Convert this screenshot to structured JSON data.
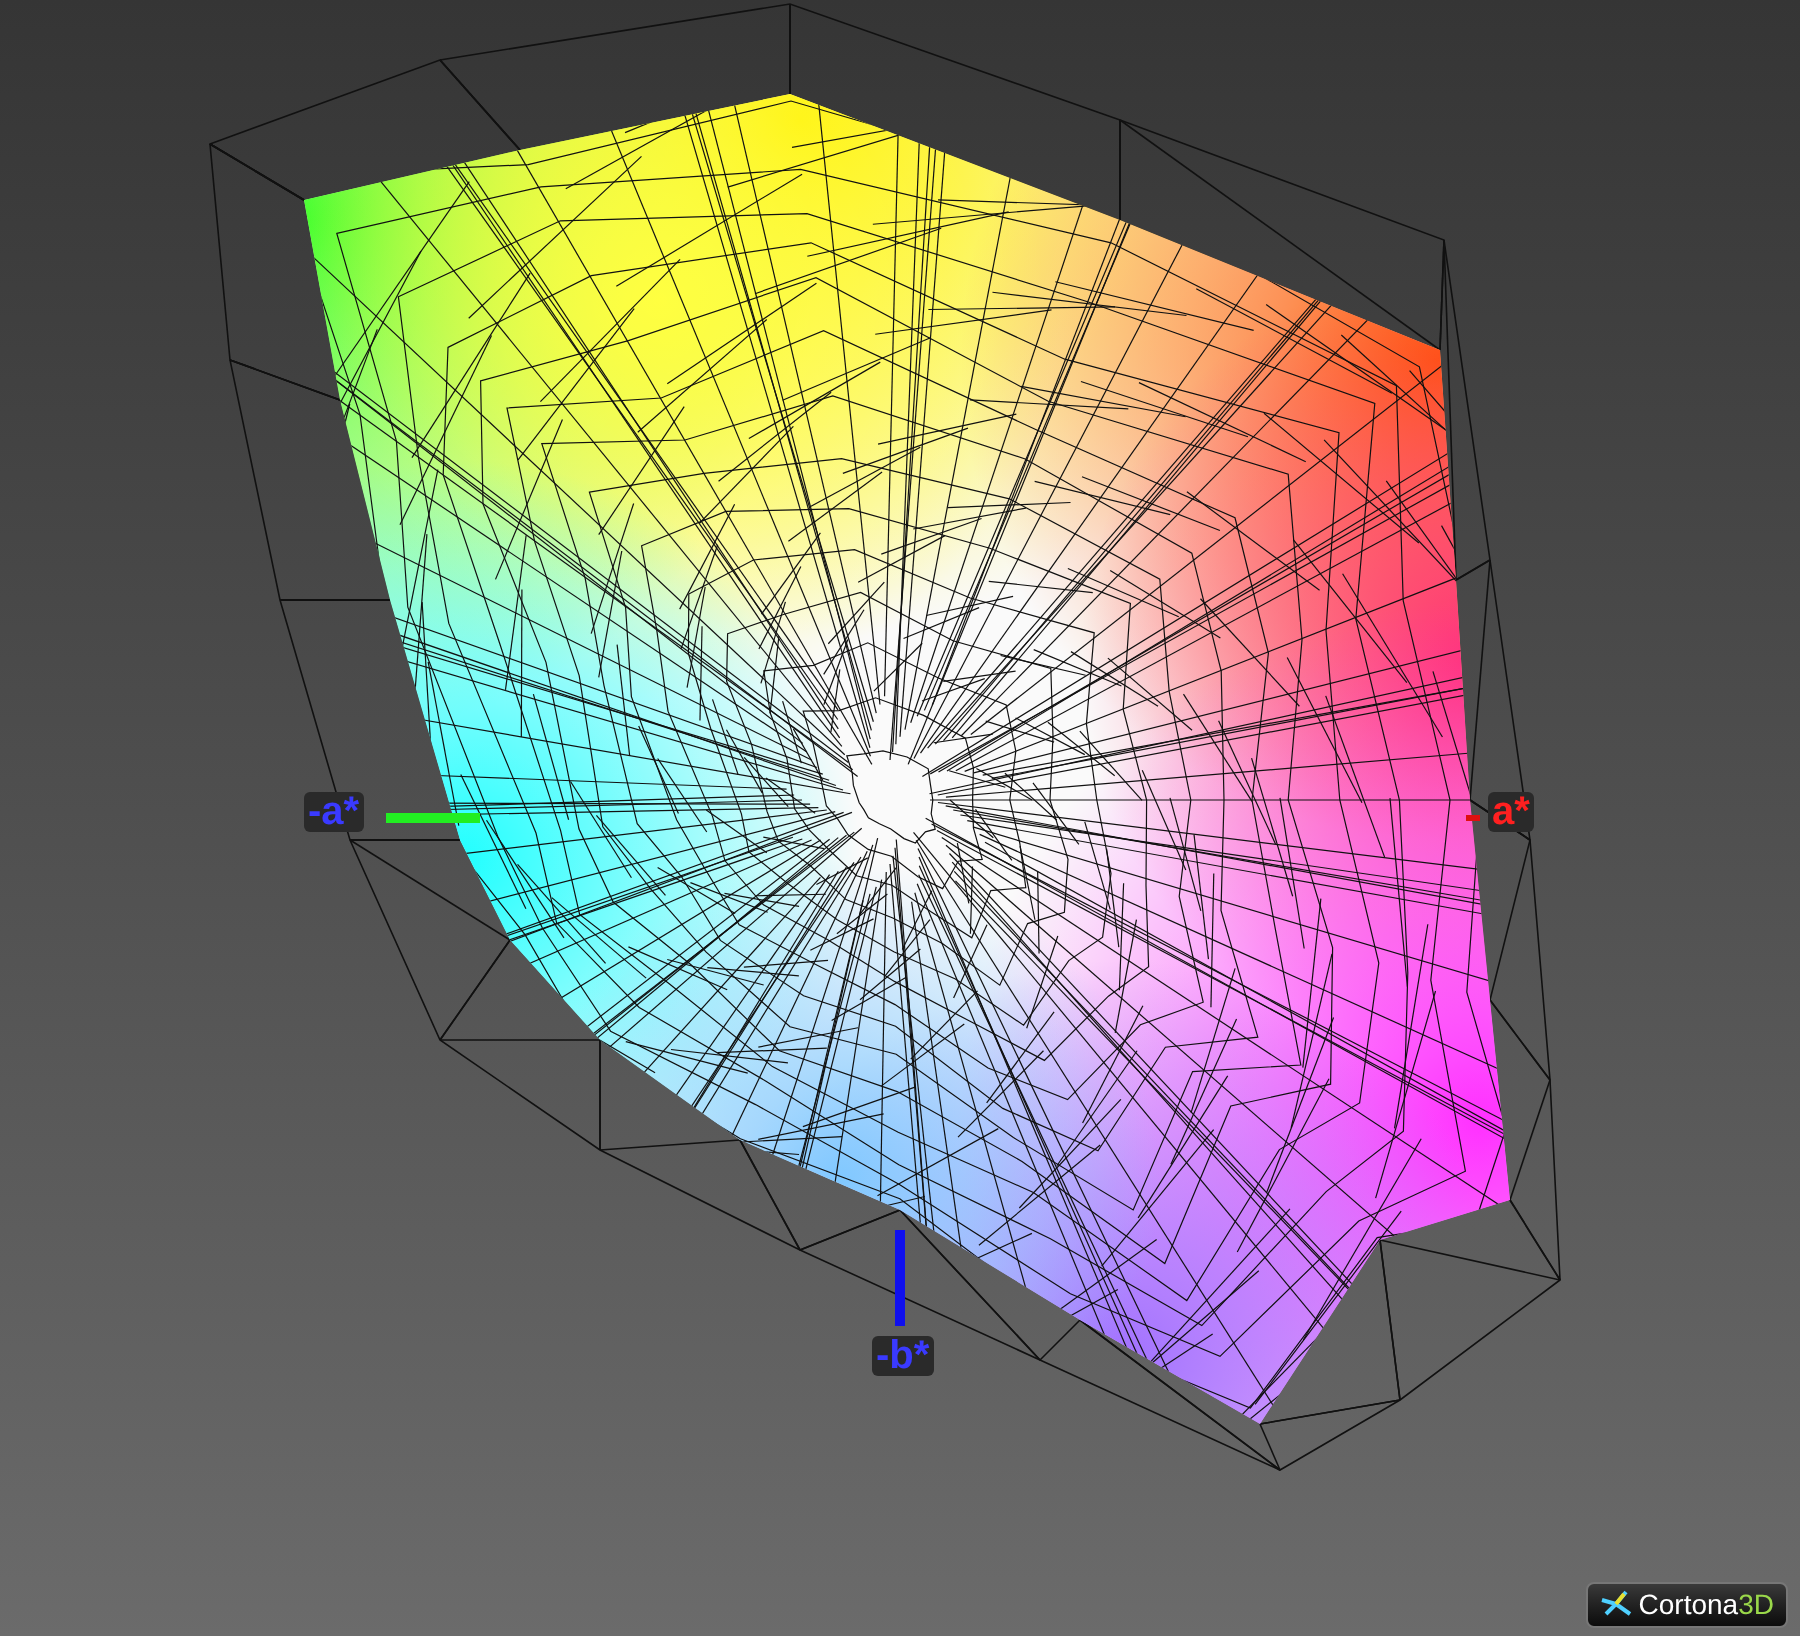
{
  "axes": [
    {
      "kind": "neg_a",
      "label": "-a*"
    },
    {
      "kind": "pos_a",
      "label": "a*"
    },
    {
      "kind": "neg_b",
      "label": "-b*"
    }
  ],
  "logo": {
    "name": "Cortona",
    "suffix": "3D"
  }
}
